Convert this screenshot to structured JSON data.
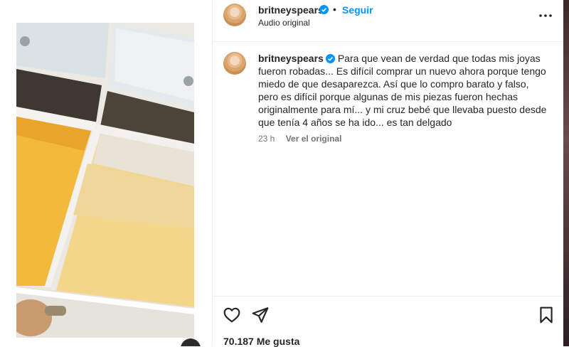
{
  "post": {
    "header": {
      "username": "britneyspears",
      "follow_label": "Seguir",
      "separator": "•",
      "audio_label": "Audio original"
    },
    "caption": {
      "username": "britneyspears",
      "text": "Para que vean de verdad que todas mis joyas fueron robadas... Es difícil comprar un nuevo ahora porque tengo miedo de que desaparezca. Así que lo compro barato y falso, pero es difícil porque algunas de mis piezas fueron hechas originalmente para mí... y mi cruz bebé que llevaba puesto desde que tenía 4 años se ha ido... es tan delgado",
      "time_ago": "23 h",
      "see_original_label": "Ver el original"
    },
    "likes_text": "70.187 Me gusta"
  },
  "icons": {
    "verified": "verified-badge-icon",
    "more": "more-options-icon",
    "like": "heart-icon",
    "share": "paper-plane-icon",
    "save": "bookmark-icon"
  },
  "colors": {
    "accent": "#0095f6",
    "text": "#262626",
    "muted": "#737373",
    "divider": "#efefef"
  }
}
